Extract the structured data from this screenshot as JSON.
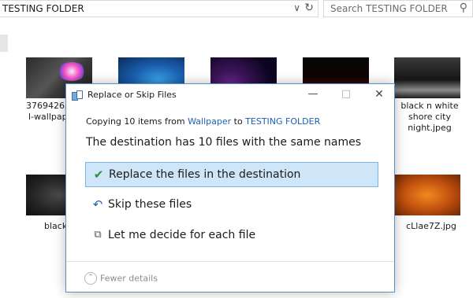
{
  "explorer": {
    "address_path": "TESTING FOLDER",
    "search_placeholder": "Search TESTING FOLDER",
    "files": [
      {
        "name_lines": [
          "37694263-",
          "l-wallpap"
        ]
      },
      {
        "name_lines": [
          "black n white",
          "shore city",
          "night.jpeg"
        ]
      },
      {
        "name_lines": [
          "black"
        ]
      },
      {
        "name_lines": [
          "cLlae7Z.jpg"
        ]
      }
    ]
  },
  "dialog": {
    "title": "Replace or Skip Files",
    "copy_prefix": "Copying 10 items from",
    "source": "Wallpaper",
    "to_word": "to",
    "destination": "TESTING FOLDER",
    "heading": "The destination has 10 files with the same names",
    "options": [
      {
        "label": "Replace the files in the destination",
        "icon": "checkmark-icon",
        "selected": true
      },
      {
        "label": "Skip these files",
        "icon": "skip-arrow-icon",
        "selected": false
      },
      {
        "label": "Let me decide for each file",
        "icon": "compare-files-icon",
        "selected": false
      }
    ],
    "fewer_details": "Fewer details"
  },
  "colors": {
    "selection_bg": "#cfe6f8",
    "selection_border": "#7fb3e0",
    "link": "#1f5fb5",
    "check": "#2e8b3a"
  }
}
